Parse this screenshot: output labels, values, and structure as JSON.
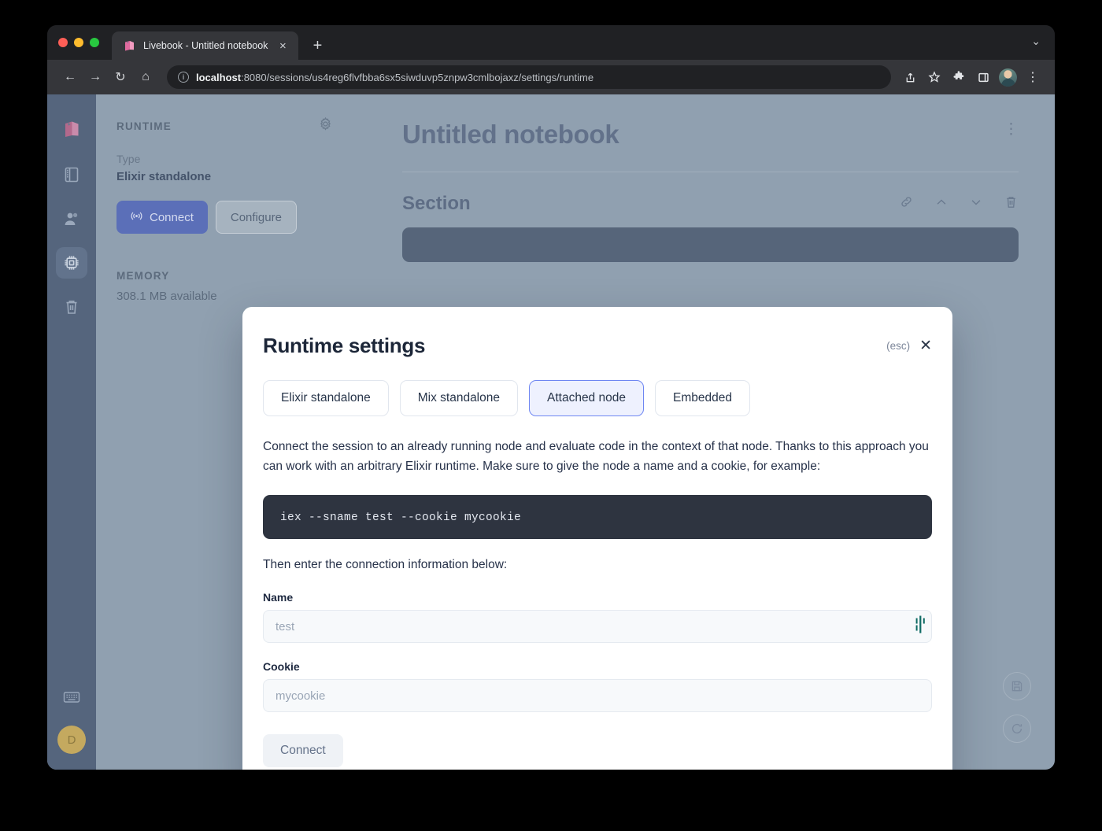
{
  "browser": {
    "tab": {
      "title": "Livebook - Untitled notebook",
      "favicon_name": "livebook-logo-icon",
      "close_label": "×",
      "new_tab_label": "+",
      "collapse_label": "⌄"
    },
    "toolbar": {
      "back_label": "←",
      "forward_label": "→",
      "reload_label": "↻",
      "home_label": "⌂",
      "url_host": "localhost",
      "url_rest": ":8080/sessions/us4reg6flvfbba6sx5siwduvp5znpw3cmlbojaxz/settings/runtime",
      "share_label": "⇧",
      "bookmark_label": "☆",
      "extensions_label": "❖",
      "sidepanel_label": "▣",
      "menu_label": "⋮"
    }
  },
  "rail": {
    "items": [
      {
        "name": "livebook-logo",
        "glyph": ""
      },
      {
        "name": "sections",
        "glyph": ""
      },
      {
        "name": "connected-users",
        "glyph": ""
      },
      {
        "name": "runtime",
        "glyph": ""
      },
      {
        "name": "bin",
        "glyph": ""
      }
    ],
    "keyboard_label": "",
    "avatar_initial": "D"
  },
  "sidebar": {
    "section_title": "RUNTIME",
    "settings_icon": "gear-icon",
    "type_label": "Type",
    "type_value": "Elixir standalone",
    "connect_label": "Connect",
    "configure_label": "Configure",
    "memory_title": "MEMORY",
    "memory_value": "308.1 MB available"
  },
  "notebook": {
    "title": "Untitled notebook",
    "menu_label": "⋮",
    "section_name": "Section",
    "tools": [
      "link-icon",
      "move-up-icon",
      "move-down-icon",
      "delete-icon"
    ],
    "float_tools": [
      "save-icon",
      "reconnect-icon"
    ]
  },
  "modal": {
    "title": "Runtime settings",
    "esc_hint": "(esc)",
    "close_label": "✕",
    "tabs": [
      {
        "label": "Elixir standalone",
        "selected": false
      },
      {
        "label": "Mix standalone",
        "selected": false
      },
      {
        "label": "Attached node",
        "selected": true
      },
      {
        "label": "Embedded",
        "selected": false
      }
    ],
    "description": "Connect the session to an already running node and evaluate code in the context of that node. Thanks to this approach you can work with an arbitrary Elixir runtime. Make sure to give the node a name and a cookie, for example:",
    "code_snippet": "iex --sname test --cookie mycookie",
    "subtext": "Then enter the connection information below:",
    "fields": [
      {
        "label": "Name",
        "value": "",
        "placeholder": "test"
      },
      {
        "label": "Cookie",
        "value": "",
        "placeholder": "mycookie"
      }
    ],
    "submit_label": "Connect"
  },
  "colors": {
    "accent_blue": "#6e86f2",
    "selected_tab_bg": "#eef1fe",
    "code_bg": "#2e3440",
    "page_bg": "#90a0b0",
    "rail_bg": "#55657d",
    "connect_btn": "#5b6fb8",
    "avatar": "#c4a95f"
  }
}
